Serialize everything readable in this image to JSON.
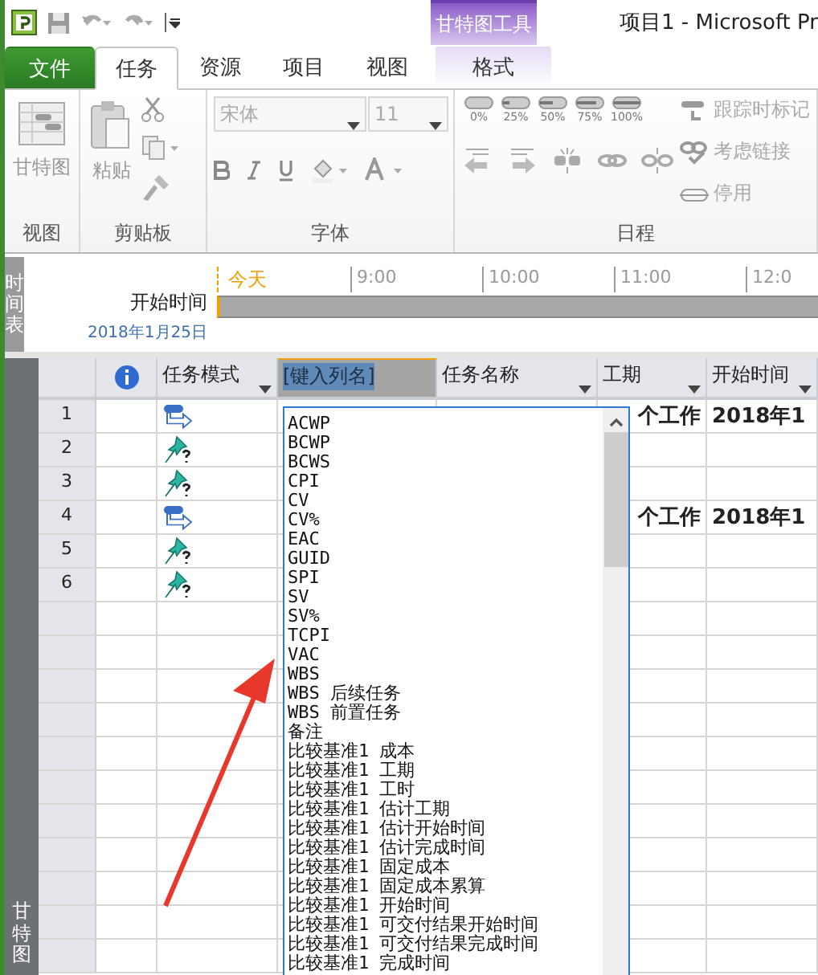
{
  "contextual_group": "甘特图工具",
  "window_title": "项目1  -  Microsoft Pr",
  "tabs": [
    {
      "label": "文件",
      "kind": "file",
      "selected": false
    },
    {
      "label": "任务",
      "kind": "normal",
      "selected": true
    },
    {
      "label": "资源",
      "kind": "normal",
      "selected": false
    },
    {
      "label": "项目",
      "kind": "normal",
      "selected": false
    },
    {
      "label": "视图",
      "kind": "normal",
      "selected": false
    },
    {
      "label": "格式",
      "kind": "contextual",
      "selected": false
    }
  ],
  "view_group": {
    "label": "视图",
    "gantt_button": "甘特图"
  },
  "clipboard_group": {
    "label": "剪贴板",
    "paste_button": "粘贴"
  },
  "font_group": {
    "label": "字体",
    "font_name": "宋体",
    "font_size": "11"
  },
  "schedule_group": {
    "label": "日程",
    "percent_buttons": [
      "0%",
      "25%",
      "50%",
      "75%",
      "100%"
    ],
    "commands": [
      {
        "label": "跟踪时标记",
        "kind": "track"
      },
      {
        "label": "考虑链接",
        "kind": "respect"
      },
      {
        "label": "停用",
        "kind": "inactivate"
      }
    ]
  },
  "timeline": {
    "side_label": "时间表",
    "today": "今天",
    "ticks": [
      "9:00",
      "10:00",
      "11:00",
      "12:0"
    ],
    "start_label": "开始时间",
    "start_date": "2018年1月25日"
  },
  "view_side_label": "甘特图",
  "table": {
    "columns": [
      {
        "kind": "normal",
        "label": "任务模式"
      },
      {
        "kind": "insert",
        "label": "[键入列名]"
      },
      {
        "kind": "normal",
        "label": "任务名称"
      },
      {
        "kind": "normal",
        "label": "工期"
      },
      {
        "kind": "normal",
        "label": "开始时间"
      }
    ],
    "rows": [
      {
        "number": "1",
        "kind": "auto",
        "duration": "个工作",
        "start": "2018年1"
      },
      {
        "number": "2",
        "kind": "manual"
      },
      {
        "number": "3",
        "kind": "manual"
      },
      {
        "number": "4",
        "kind": "auto",
        "duration": "个工作",
        "start": "2018年1"
      },
      {
        "number": "5",
        "kind": "manual"
      },
      {
        "number": "6",
        "kind": "manual"
      }
    ]
  },
  "field_list": [
    "ACWP",
    "BCWP",
    "BCWS",
    "CPI",
    "CV",
    "CV%",
    "EAC",
    "GUID",
    "SPI",
    "SV",
    "SV%",
    "TCPI",
    "VAC",
    "WBS",
    "WBS 后续任务",
    "WBS 前置任务",
    "备注",
    "比较基准1 成本",
    "比较基准1 工期",
    "比较基准1 工时",
    "比较基准1 估计工期",
    "比较基准1 估计开始时间",
    "比较基准1 估计完成时间",
    "比较基准1 固定成本",
    "比较基准1 固定成本累算",
    "比较基准1 开始时间",
    "比较基准1 可交付结果开始时间",
    "比较基准1 可交付结果完成时间",
    "比较基准1 完成时间"
  ]
}
